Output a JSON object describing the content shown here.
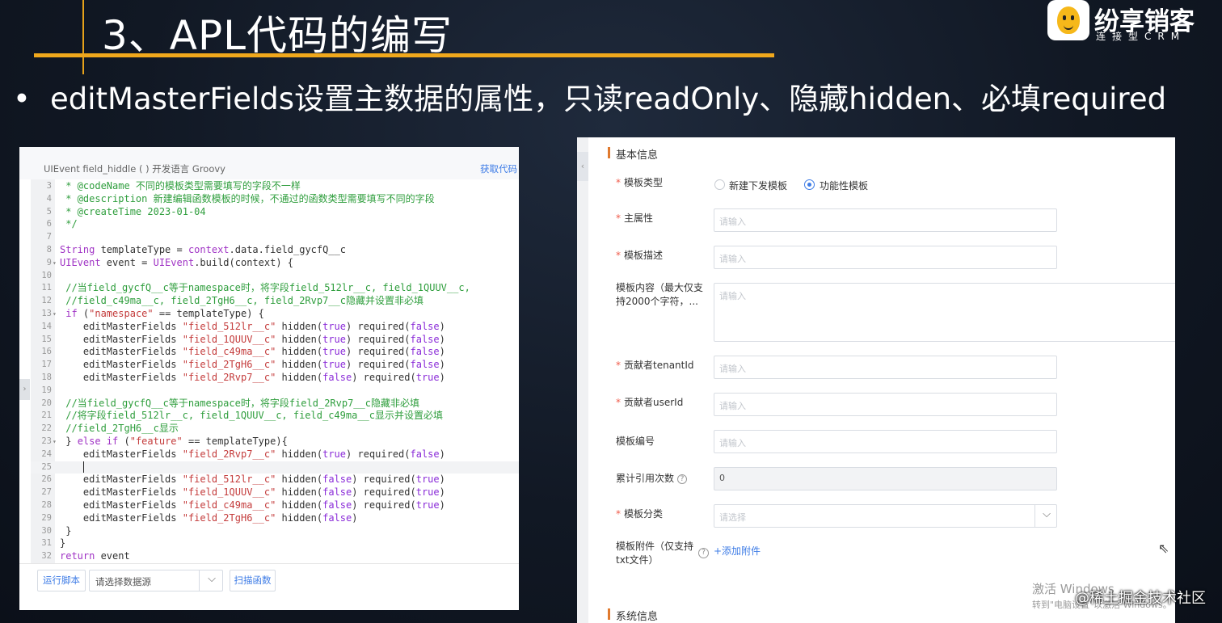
{
  "slide": {
    "title": "3、APL代码的编写",
    "bullet": "editMasterFields设置主数据的属性，只读readOnly、隐藏hidden、必填required",
    "logo": {
      "name": "纷享销客",
      "tagline": "连接型CRM",
      "icon": "bee-mascot-icon"
    }
  },
  "code_editor": {
    "header_left": "UIEvent field_hiddle ( )   开发语言 Groovy",
    "header_right": "获取代码",
    "lines": [
      {
        "n": "3",
        "fold": "",
        "active": false,
        "segs": [
          {
            "c": "cm",
            "t": " * @codeName 不同的模板类型需要填写的字段不一样"
          }
        ]
      },
      {
        "n": "4",
        "fold": "",
        "active": false,
        "segs": [
          {
            "c": "cm",
            "t": " * @description 新建编辑函数模板的时候，不通过的函数类型需要填写不同的字段"
          }
        ]
      },
      {
        "n": "5",
        "fold": "",
        "active": false,
        "segs": [
          {
            "c": "cm",
            "t": " * @createTime 2023-01-04"
          }
        ]
      },
      {
        "n": "6",
        "fold": "",
        "active": false,
        "segs": [
          {
            "c": "cm",
            "t": " */"
          }
        ]
      },
      {
        "n": "7",
        "fold": "",
        "active": false,
        "segs": []
      },
      {
        "n": "8",
        "fold": "",
        "active": false,
        "segs": [
          {
            "c": "kw",
            "t": "String"
          },
          {
            "c": "",
            "t": " templateType = "
          },
          {
            "c": "kw",
            "t": "context"
          },
          {
            "c": "",
            "t": ".data.field_gycfQ__c"
          }
        ]
      },
      {
        "n": "9",
        "fold": "▾",
        "active": false,
        "segs": [
          {
            "c": "kw",
            "t": "UIEvent"
          },
          {
            "c": "",
            "t": " event = "
          },
          {
            "c": "kw",
            "t": "UIEvent"
          },
          {
            "c": "",
            "t": ".build(context) {"
          }
        ]
      },
      {
        "n": "10",
        "fold": "",
        "active": false,
        "segs": []
      },
      {
        "n": "11",
        "fold": "",
        "active": false,
        "segs": [
          {
            "c": "cm",
            "t": " //当field_gycfQ__c等于namespace时，将字段field_512lr__c, field_1QUUV__c,"
          }
        ]
      },
      {
        "n": "12",
        "fold": "",
        "active": false,
        "segs": [
          {
            "c": "cm",
            "t": " //field_c49ma__c, field_2TgH6__c, field_2Rvp7__c隐藏并设置非必填"
          }
        ]
      },
      {
        "n": "13",
        "fold": "▾",
        "active": false,
        "segs": [
          {
            "c": "kw",
            "t": " if"
          },
          {
            "c": "",
            "t": " ("
          },
          {
            "c": "st",
            "t": "\"namespace\""
          },
          {
            "c": "",
            "t": " == templateType) {"
          }
        ]
      },
      {
        "n": "14",
        "fold": "",
        "active": false,
        "segs": [
          {
            "c": "",
            "t": "    editMasterFields "
          },
          {
            "c": "st",
            "t": "\"field_512lr__c\""
          },
          {
            "c": "",
            "t": " hidden("
          },
          {
            "c": "bl",
            "t": "true"
          },
          {
            "c": "",
            "t": ") required("
          },
          {
            "c": "bl",
            "t": "false"
          },
          {
            "c": "",
            "t": ")"
          }
        ]
      },
      {
        "n": "15",
        "fold": "",
        "active": false,
        "segs": [
          {
            "c": "",
            "t": "    editMasterFields "
          },
          {
            "c": "st",
            "t": "\"field_1QUUV__c\""
          },
          {
            "c": "",
            "t": " hidden("
          },
          {
            "c": "bl",
            "t": "true"
          },
          {
            "c": "",
            "t": ") required("
          },
          {
            "c": "bl",
            "t": "false"
          },
          {
            "c": "",
            "t": ")"
          }
        ]
      },
      {
        "n": "16",
        "fold": "",
        "active": false,
        "segs": [
          {
            "c": "",
            "t": "    editMasterFields "
          },
          {
            "c": "st",
            "t": "\"field_c49ma__c\""
          },
          {
            "c": "",
            "t": " hidden("
          },
          {
            "c": "bl",
            "t": "true"
          },
          {
            "c": "",
            "t": ") required("
          },
          {
            "c": "bl",
            "t": "false"
          },
          {
            "c": "",
            "t": ")"
          }
        ]
      },
      {
        "n": "17",
        "fold": "",
        "active": false,
        "segs": [
          {
            "c": "",
            "t": "    editMasterFields "
          },
          {
            "c": "st",
            "t": "\"field_2TgH6__c\""
          },
          {
            "c": "",
            "t": " hidden("
          },
          {
            "c": "bl",
            "t": "true"
          },
          {
            "c": "",
            "t": ") required("
          },
          {
            "c": "bl",
            "t": "false"
          },
          {
            "c": "",
            "t": ")"
          }
        ]
      },
      {
        "n": "18",
        "fold": "",
        "active": false,
        "segs": [
          {
            "c": "",
            "t": "    editMasterFields "
          },
          {
            "c": "st",
            "t": "\"field_2Rvp7__c\""
          },
          {
            "c": "",
            "t": " hidden("
          },
          {
            "c": "bl",
            "t": "false"
          },
          {
            "c": "",
            "t": ") required("
          },
          {
            "c": "bl",
            "t": "true"
          },
          {
            "c": "",
            "t": ")"
          }
        ]
      },
      {
        "n": "19",
        "fold": "",
        "active": false,
        "segs": []
      },
      {
        "n": "20",
        "fold": "",
        "active": false,
        "segs": [
          {
            "c": "cm",
            "t": " //当field_gycfQ__c等于namespace时，将字段field_2Rvp7__c隐藏非必填"
          }
        ]
      },
      {
        "n": "21",
        "fold": "",
        "active": false,
        "segs": [
          {
            "c": "cm",
            "t": " //将字段field_512lr__c, field_1QUUV__c, field_c49ma__c显示并设置必填"
          }
        ]
      },
      {
        "n": "22",
        "fold": "",
        "active": false,
        "segs": [
          {
            "c": "cm",
            "t": " //field_2TgH6__c显示"
          }
        ]
      },
      {
        "n": "23",
        "fold": "▾",
        "active": false,
        "segs": [
          {
            "c": "",
            "t": " } "
          },
          {
            "c": "kw",
            "t": "else if"
          },
          {
            "c": "",
            "t": " ("
          },
          {
            "c": "st",
            "t": "\"feature\""
          },
          {
            "c": "",
            "t": " == templateType){"
          }
        ]
      },
      {
        "n": "24",
        "fold": "",
        "active": false,
        "segs": [
          {
            "c": "",
            "t": "    editMasterFields "
          },
          {
            "c": "st",
            "t": "\"field_2Rvp7__c\""
          },
          {
            "c": "",
            "t": " hidden("
          },
          {
            "c": "bl",
            "t": "true"
          },
          {
            "c": "",
            "t": ") required("
          },
          {
            "c": "bl",
            "t": "false"
          },
          {
            "c": "",
            "t": ")"
          }
        ]
      },
      {
        "n": "25",
        "fold": "",
        "active": true,
        "cursor": true,
        "segs": [
          {
            "c": "",
            "t": "    "
          }
        ]
      },
      {
        "n": "26",
        "fold": "",
        "active": false,
        "segs": [
          {
            "c": "",
            "t": "    editMasterFields "
          },
          {
            "c": "st",
            "t": "\"field_512lr__c\""
          },
          {
            "c": "",
            "t": " hidden("
          },
          {
            "c": "bl",
            "t": "false"
          },
          {
            "c": "",
            "t": ") required("
          },
          {
            "c": "bl",
            "t": "true"
          },
          {
            "c": "",
            "t": ")"
          }
        ]
      },
      {
        "n": "27",
        "fold": "",
        "active": false,
        "segs": [
          {
            "c": "",
            "t": "    editMasterFields "
          },
          {
            "c": "st",
            "t": "\"field_1QUUV__c\""
          },
          {
            "c": "",
            "t": " hidden("
          },
          {
            "c": "bl",
            "t": "false"
          },
          {
            "c": "",
            "t": ") required("
          },
          {
            "c": "bl",
            "t": "true"
          },
          {
            "c": "",
            "t": ")"
          }
        ]
      },
      {
        "n": "28",
        "fold": "",
        "active": false,
        "segs": [
          {
            "c": "",
            "t": "    editMasterFields "
          },
          {
            "c": "st",
            "t": "\"field_c49ma__c\""
          },
          {
            "c": "",
            "t": " hidden("
          },
          {
            "c": "bl",
            "t": "false"
          },
          {
            "c": "",
            "t": ") required("
          },
          {
            "c": "bl",
            "t": "true"
          },
          {
            "c": "",
            "t": ")"
          }
        ]
      },
      {
        "n": "29",
        "fold": "",
        "active": false,
        "segs": [
          {
            "c": "",
            "t": "    editMasterFields "
          },
          {
            "c": "st",
            "t": "\"field_2TgH6__c\""
          },
          {
            "c": "",
            "t": " hidden("
          },
          {
            "c": "bl",
            "t": "false"
          },
          {
            "c": "",
            "t": ")"
          }
        ]
      },
      {
        "n": "30",
        "fold": "",
        "active": false,
        "segs": [
          {
            "c": "",
            "t": " }"
          }
        ]
      },
      {
        "n": "31",
        "fold": "",
        "active": false,
        "segs": [
          {
            "c": "",
            "t": "}"
          }
        ]
      },
      {
        "n": "32",
        "fold": "",
        "active": false,
        "segs": [
          {
            "c": "kw",
            "t": "return"
          },
          {
            "c": "",
            "t": " event"
          }
        ]
      }
    ],
    "footer": {
      "run_label": "运行脚本",
      "source_select_value": "请选择数据源",
      "scan_label": "扫描函数"
    }
  },
  "form": {
    "section_basic": "基本信息",
    "section_system": "系统信息",
    "template_type": {
      "label": "模板类型",
      "options": [
        "新建下发模板",
        "功能性模板"
      ],
      "selected": "功能性模板"
    },
    "fields": {
      "main_attr": {
        "label": "主属性",
        "placeholder": "请输入"
      },
      "desc": {
        "label": "模板描述",
        "placeholder": "请输入"
      },
      "content": {
        "label": "模板内容（最大仅支持2000个字符，...",
        "placeholder": "请输入"
      },
      "tenant": {
        "label": "贡献者tenantId",
        "placeholder": "请输入"
      },
      "user": {
        "label": "贡献者userId",
        "placeholder": "请输入"
      },
      "code": {
        "label": "模板编号",
        "placeholder": "请输入"
      },
      "count": {
        "label": "累计引用次数",
        "value": "0"
      },
      "category": {
        "label": "模板分类",
        "placeholder": "请选择"
      },
      "attach": {
        "label": "模板附件（仅支持txt文件）",
        "link": "+添加附件"
      }
    }
  },
  "overlays": {
    "activate_line1": "激活 Windows",
    "activate_line2": "转到\"电脑设置\"以激活 Windows。",
    "community": "@稀土掘金技术社区"
  }
}
